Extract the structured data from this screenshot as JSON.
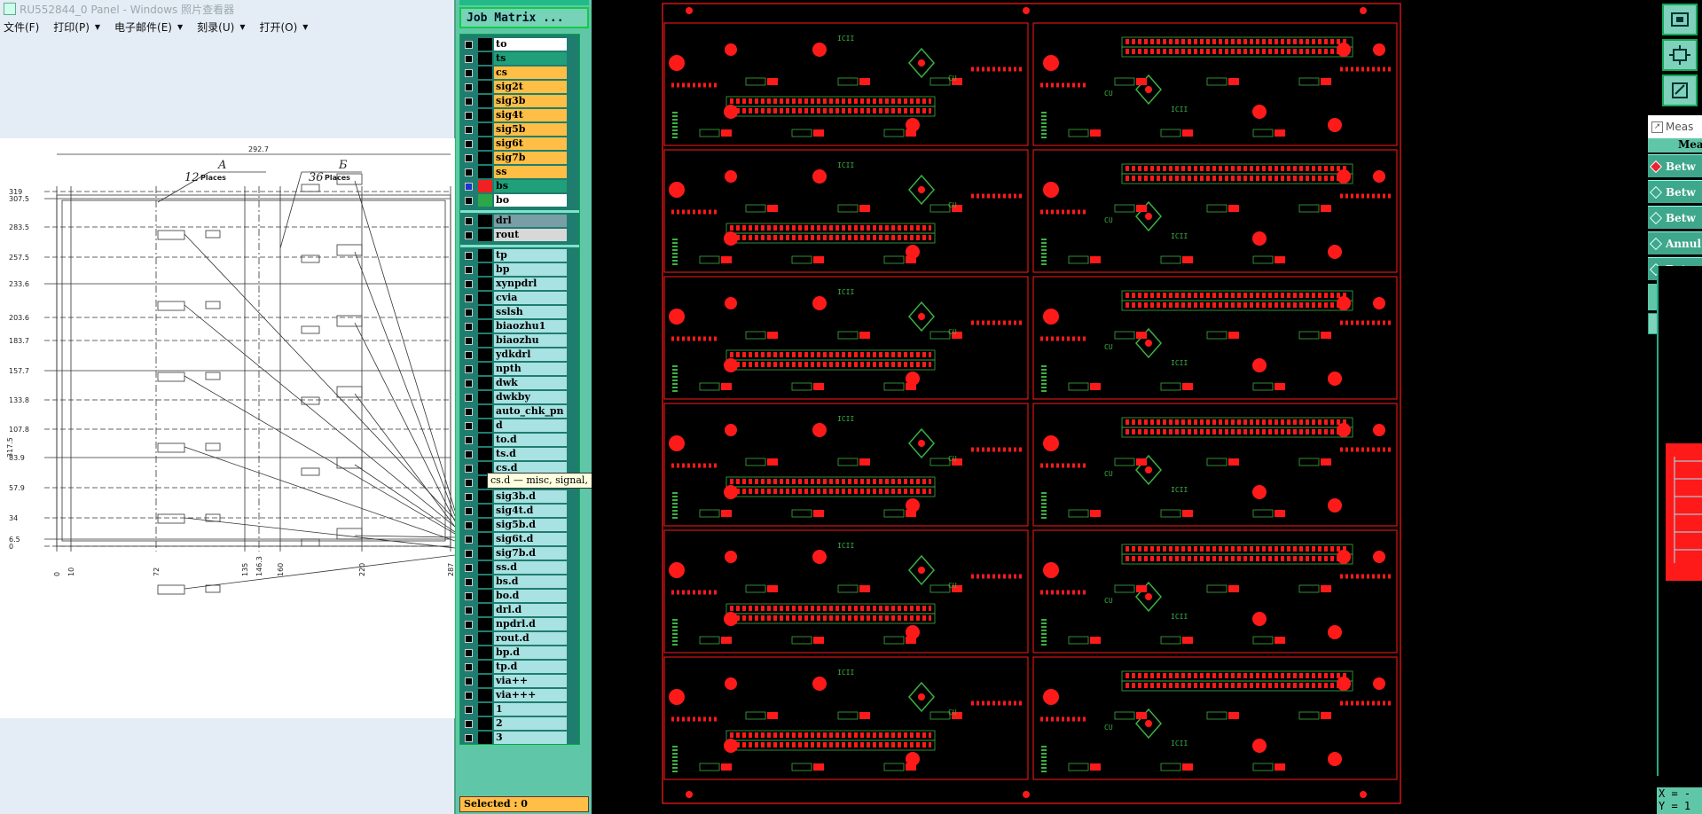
{
  "viewer": {
    "title": "RU552844_0 Panel - Windows 照片查看器",
    "menu": [
      "文件(F)",
      "打印(P)",
      "电子邮件(E)",
      "刻录(U)",
      "打开(O)"
    ],
    "drawing": {
      "dim_top": "292.7",
      "col_a": "A",
      "col_b": "Б",
      "count_a": "12",
      "count_b": "36",
      "places_label": "Places",
      "y_ticks": [
        "319",
        "307.5",
        "283.5",
        "257.5",
        "233.6",
        "203.6",
        "183.7",
        "157.7",
        "133.8",
        "107.8",
        "83.9",
        "57.9",
        "34",
        "6.5",
        "0"
      ],
      "x_ticks": [
        "0",
        "10",
        "72",
        "135",
        "146.3",
        "160",
        "220",
        "287"
      ],
      "dim_left": "317.5"
    }
  },
  "matrix": {
    "title": "Job Matrix ...",
    "selected": "Selected : 0",
    "tooltip": "cs.d — misc, signal, positive",
    "groups": [
      [
        {
          "name": "to",
          "color": "#ffffff"
        },
        {
          "name": "ts",
          "color": "#1fa07a"
        },
        {
          "name": "cs",
          "color": "#ffbe45"
        },
        {
          "name": "sig2t",
          "color": "#ffbe45"
        },
        {
          "name": "sig3b",
          "color": "#ffbe45"
        },
        {
          "name": "sig4t",
          "color": "#ffbe45"
        },
        {
          "name": "sig5b",
          "color": "#ffbe45"
        },
        {
          "name": "sig6t",
          "color": "#ffbe45"
        },
        {
          "name": "sig7b",
          "color": "#ffbe45"
        },
        {
          "name": "ss",
          "color": "#ffbe45"
        },
        {
          "name": "bs",
          "color": "#1fa07a",
          "active": true
        },
        {
          "name": "bo",
          "color": "#ffffff",
          "mark": "#2ca84a"
        }
      ],
      [
        {
          "name": "drl",
          "color": "#7a9ea6"
        },
        {
          "name": "rout",
          "color": "#d8d8d8"
        }
      ],
      [
        {
          "name": "tp",
          "color": "#a8e2e2"
        },
        {
          "name": "bp",
          "color": "#a8e2e2"
        },
        {
          "name": "xynpdrl",
          "color": "#a8e2e2"
        },
        {
          "name": "cvia",
          "color": "#a8e2e2"
        },
        {
          "name": "sslsh",
          "color": "#a8e2e2"
        },
        {
          "name": "biaozhu1",
          "color": "#a8e2e2"
        },
        {
          "name": "biaozhu",
          "color": "#a8e2e2"
        },
        {
          "name": "ydkdrl",
          "color": "#a8e2e2"
        },
        {
          "name": "npth",
          "color": "#a8e2e2"
        },
        {
          "name": "dwk",
          "color": "#a8e2e2"
        },
        {
          "name": "dwkby",
          "color": "#a8e2e2"
        },
        {
          "name": "auto_chk_pn",
          "color": "#a8e2e2"
        },
        {
          "name": "d",
          "color": "#a8e2e2"
        },
        {
          "name": "to.d",
          "color": "#a8e2e2"
        },
        {
          "name": "ts.d",
          "color": "#a8e2e2"
        },
        {
          "name": "cs.d",
          "color": "#a8e2e2"
        },
        {
          "name": "sig2t.d",
          "color": "#a8e2e2"
        },
        {
          "name": "sig3b.d",
          "color": "#a8e2e2"
        },
        {
          "name": "sig4t.d",
          "color": "#a8e2e2"
        },
        {
          "name": "sig5b.d",
          "color": "#a8e2e2"
        },
        {
          "name": "sig6t.d",
          "color": "#a8e2e2"
        },
        {
          "name": "sig7b.d",
          "color": "#a8e2e2"
        },
        {
          "name": "ss.d",
          "color": "#a8e2e2"
        },
        {
          "name": "bs.d",
          "color": "#a8e2e2"
        },
        {
          "name": "bo.d",
          "color": "#a8e2e2"
        },
        {
          "name": "drl.d",
          "color": "#a8e2e2"
        },
        {
          "name": "npdrl.d",
          "color": "#a8e2e2"
        },
        {
          "name": "rout.d",
          "color": "#a8e2e2"
        },
        {
          "name": "bp.d",
          "color": "#a8e2e2"
        },
        {
          "name": "tp.d",
          "color": "#a8e2e2"
        },
        {
          "name": "via++",
          "color": "#a8e2e2"
        },
        {
          "name": "via+++",
          "color": "#a8e2e2"
        },
        {
          "name": "1",
          "color": "#a8e2e2"
        },
        {
          "name": "2",
          "color": "#a8e2e2"
        },
        {
          "name": "3",
          "color": "#a8e2e2"
        }
      ]
    ]
  },
  "pcb": {
    "board_labels": [
      "ICII",
      "CU"
    ]
  },
  "measure": {
    "title": "Meas",
    "subheader": "Mea",
    "options": [
      {
        "label": "Betw",
        "selected": true
      },
      {
        "label": "Betw",
        "selected": false
      },
      {
        "label": "Betw",
        "selected": false
      },
      {
        "label": "Annul",
        "selected": false
      },
      {
        "label": "Betw",
        "selected": false
      }
    ],
    "x_readout": "X = -",
    "y_readout": "Y = 1"
  },
  "colors": {
    "layer_bg": "#000000",
    "copper_red": "#ff1a1a",
    "silk_green": "#3cb043",
    "matrix_bg": "#5fc7a8"
  }
}
